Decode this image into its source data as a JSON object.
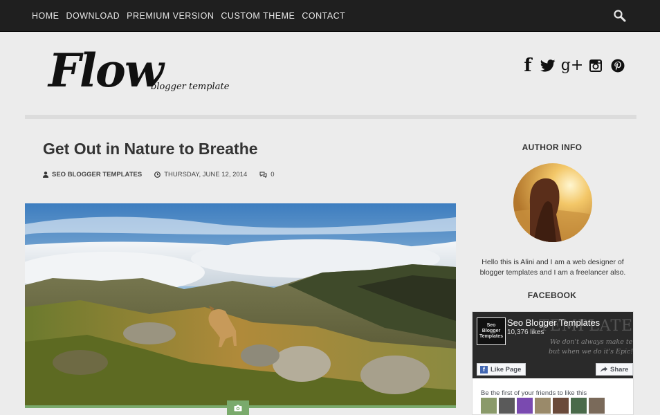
{
  "nav": {
    "items": [
      "HOME",
      "DOWNLOAD",
      "PREMIUM VERSION",
      "CUSTOM THEME",
      "CONTACT"
    ],
    "search_icon": "search-icon"
  },
  "header": {
    "logo_main": "Flow",
    "logo_sub": "blogger template",
    "social_icons": [
      "facebook-icon",
      "twitter-icon",
      "google-plus-icon",
      "instagram-icon",
      "pinterest-icon"
    ],
    "google_plus_glyph": "g+",
    "facebook_glyph": "f"
  },
  "post": {
    "title": "Get Out in Nature to Breathe",
    "author": "SEO BLOGGER TEMPLATES",
    "date": "THURSDAY, JUNE 12, 2014",
    "comments": "0",
    "image_icon": "camera-icon"
  },
  "sidebar": {
    "author_info_title": "AUTHOR INFO",
    "author_bio": "Hello this is Alini and I am a web designer of blogger templates and I am a freelancer also.",
    "facebook_title": "FACEBOOK",
    "facebook": {
      "page_name": "Seo Blogger Templates",
      "likes": "10,376 likes",
      "thumb_lines": [
        "Seo",
        "Blogger",
        "Templates"
      ],
      "cover_text_big": "TEMPLATES",
      "cover_text_line1": "We don't always make templates",
      "cover_text_line2": "but when we do it's Epic!",
      "like_button": "Like Page",
      "share_button": "Share",
      "friends_text": "Be the first of your friends to like this"
    }
  },
  "colors": {
    "nav_bg": "#1f1f1f",
    "page_bg": "#ececec",
    "accent_green": "#7aaa6c",
    "facebook_blue": "#4267b2"
  }
}
